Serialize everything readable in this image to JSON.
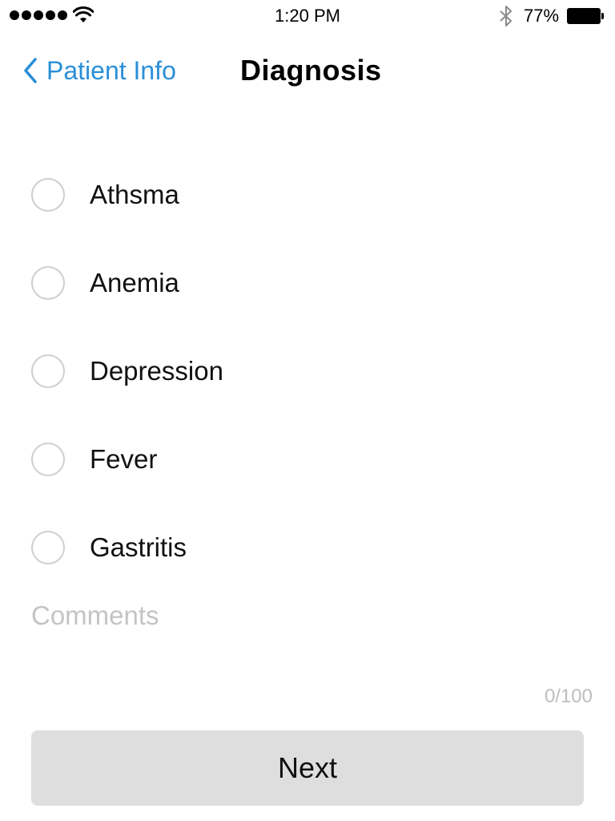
{
  "status_bar": {
    "time": "1:20 PM",
    "battery_percent": "77%",
    "signal_dots": 5,
    "icons": [
      "signal-dots-icon",
      "wifi-icon",
      "bluetooth-icon",
      "battery-icon"
    ]
  },
  "nav": {
    "back_label": "Patient Info",
    "title": "Diagnosis",
    "back_icon": "chevron-left-icon"
  },
  "options": [
    {
      "label": "Athsma",
      "selected": false
    },
    {
      "label": "Anemia",
      "selected": false
    },
    {
      "label": "Depression",
      "selected": false
    },
    {
      "label": "Fever",
      "selected": false
    },
    {
      "label": "Gastritis",
      "selected": false
    }
  ],
  "comments": {
    "placeholder": "Comments",
    "value": "",
    "counter": "0/100"
  },
  "next_button": {
    "label": "Next"
  },
  "colors": {
    "accent": "#2a8fd8",
    "button_bg": "#dedede",
    "radio_border": "#cfcfcf",
    "placeholder": "#c4c4c4"
  }
}
